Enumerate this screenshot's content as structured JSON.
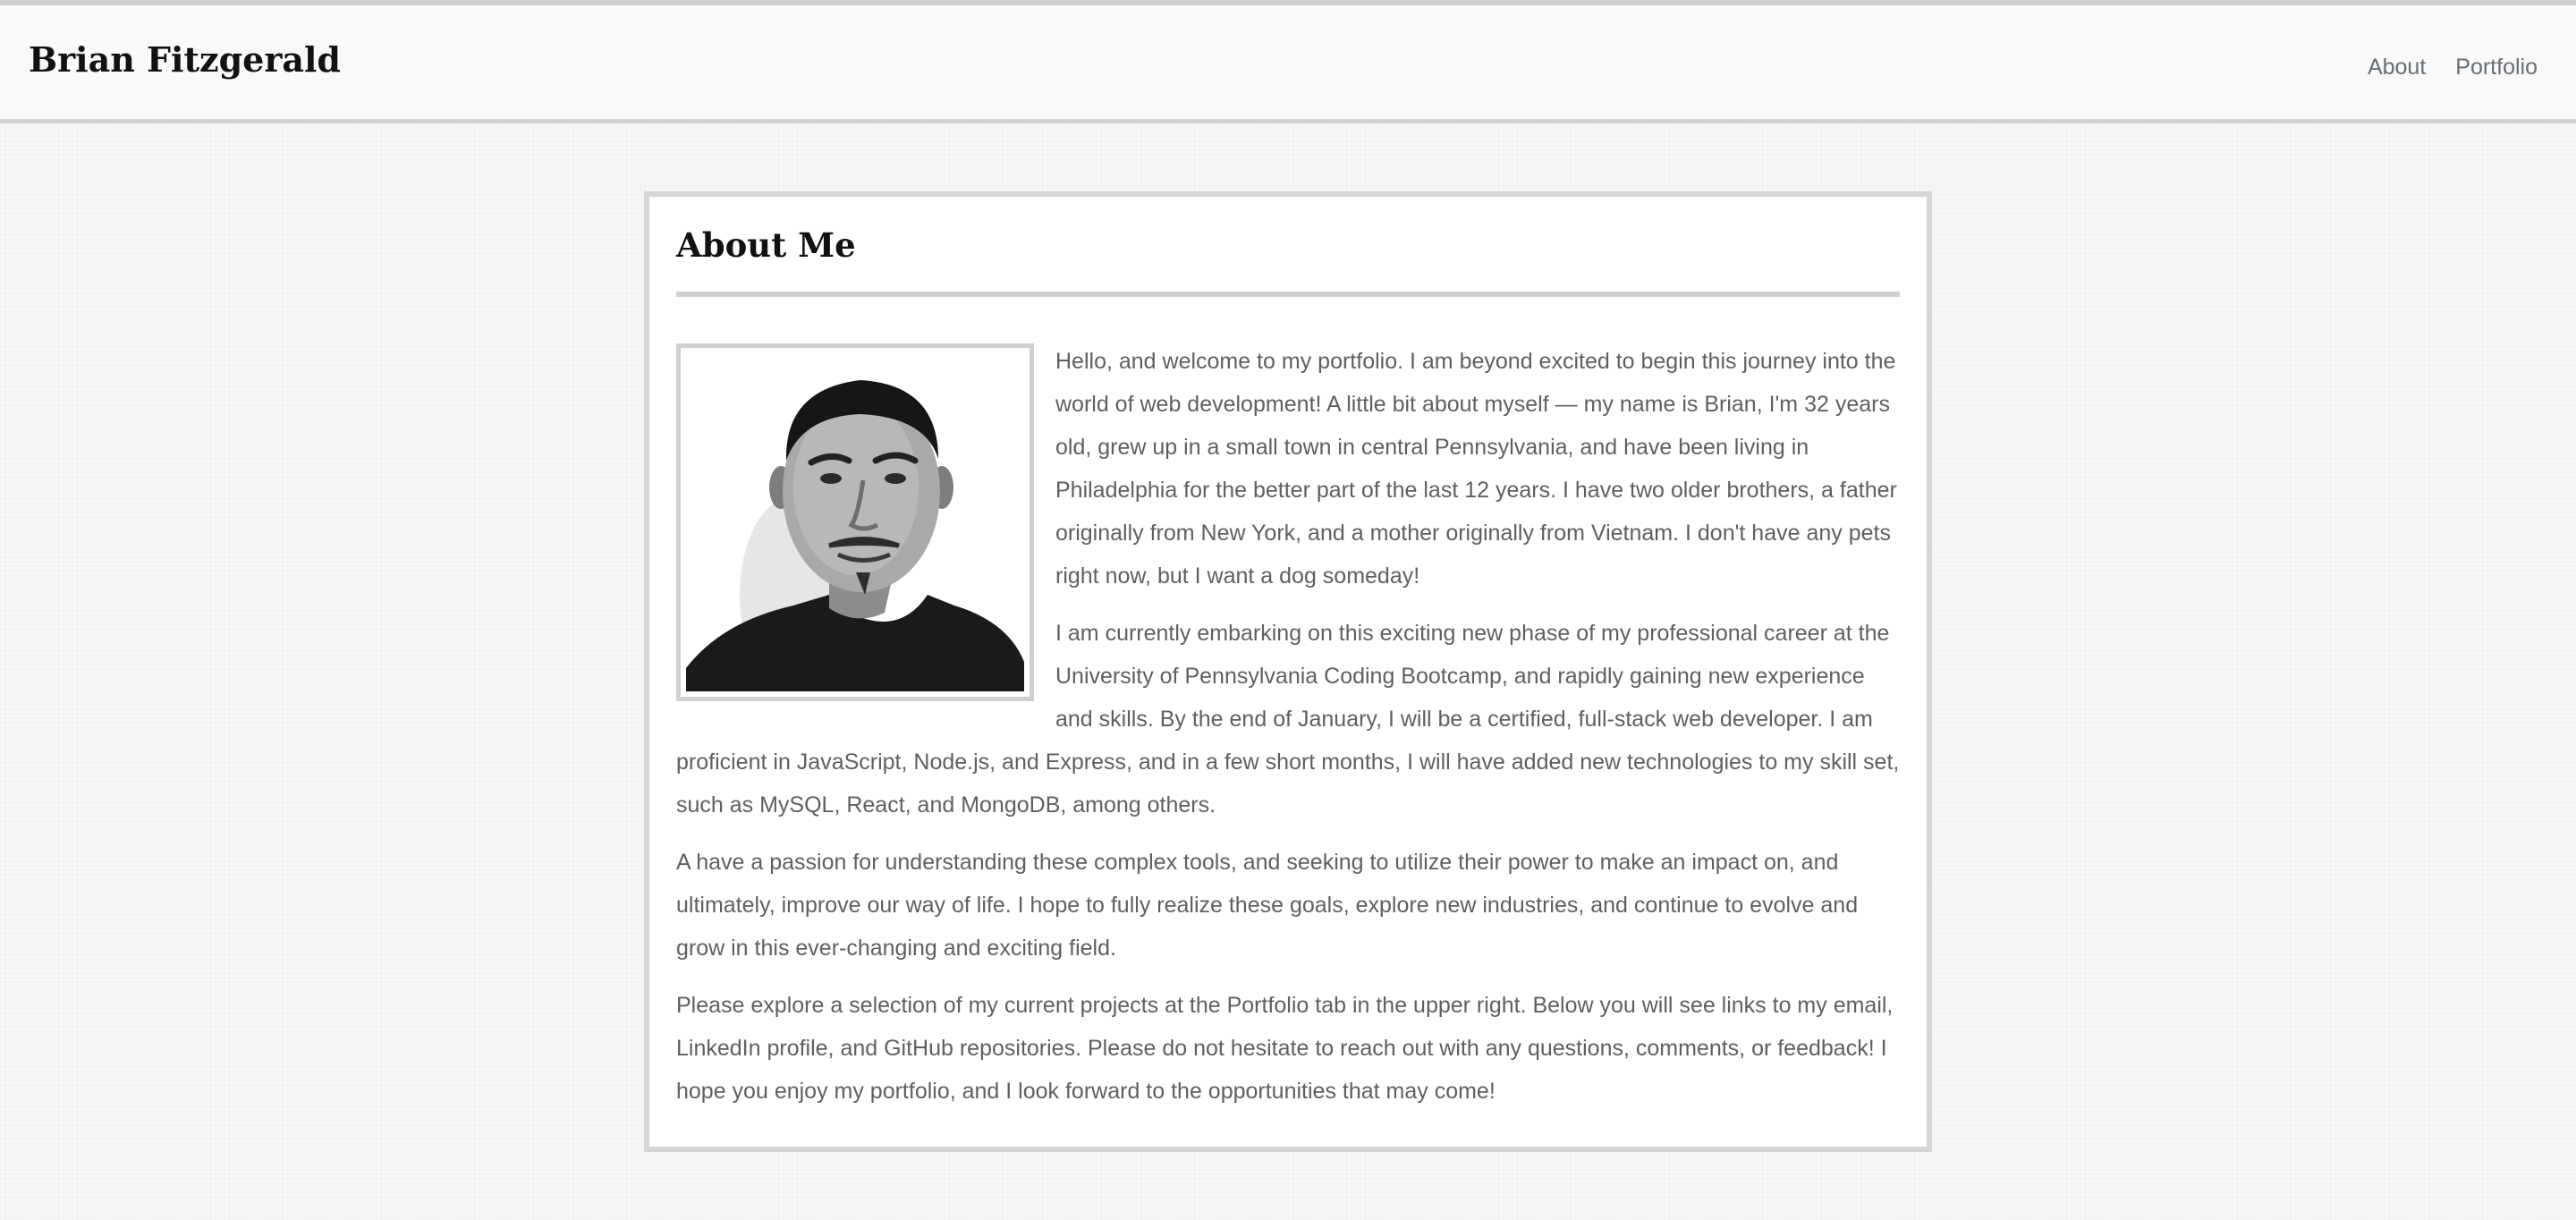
{
  "nav": {
    "brand": "Brian Fitzgerald",
    "links": [
      {
        "label": "About"
      },
      {
        "label": "Portfolio"
      }
    ]
  },
  "about": {
    "title": "About Me",
    "paragraphs": [
      "Hello, and welcome to my portfolio. I am beyond excited to begin this journey into the world of web development! A little bit about myself — my name is Brian, I'm 32 years old, grew up in a small town in central Pennsylvania, and have been living in Philadelphia for the better part of the last 12 years. I have two older brothers, a father originally from New York, and a mother originally from Vietnam. I don't have any pets right now, but I want a dog someday!",
      "I am currently embarking on this exciting new phase of my professional career at the University of Pennsylvania Coding Bootcamp, and rapidly gaining new experience and skills. By the end of January, I will be a certified, full-stack web developer. I am proficient in JavaScript, Node.js, and Express, and in a few short months, I will have added new technologies to my skill set, such as MySQL, React, and MongoDB, among others.",
      "A have a passion for understanding these complex tools, and seeking to utilize their power to make an impact on, and ultimately, improve our way of life. I hope to fully realize these goals, explore new industries, and continue to evolve and grow in this ever-changing and exciting field.",
      "Please explore a selection of my current projects at the Portfolio tab in the upper right. Below you will see links to my email, LinkedIn profile, and GitHub repositories. Please do not hesitate to reach out with any questions, comments, or feedback! I hope you enjoy my portfolio, and I look forward to the opportunities that may come!"
    ]
  }
}
